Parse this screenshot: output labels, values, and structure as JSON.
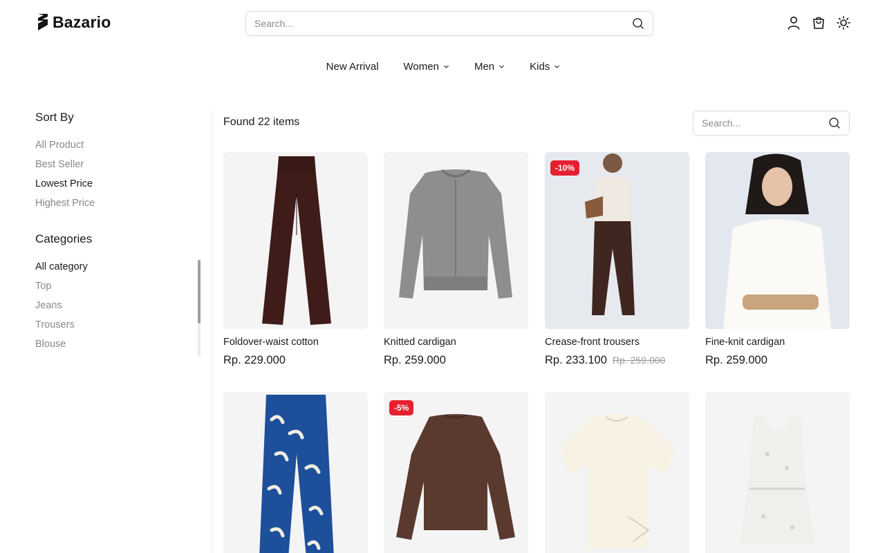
{
  "brand": {
    "name": "Bazario"
  },
  "header": {
    "search_placeholder": "Search...",
    "icons": [
      "user-icon",
      "cart-icon",
      "sun-icon"
    ]
  },
  "nav": [
    {
      "label": "New Arrival",
      "has_dropdown": false
    },
    {
      "label": "Women",
      "has_dropdown": true
    },
    {
      "label": "Men",
      "has_dropdown": true
    },
    {
      "label": "Kids",
      "has_dropdown": true
    }
  ],
  "sidebar": {
    "sort_title": "Sort By",
    "sort_options": [
      "All Product",
      "Best Seller",
      "Lowest Price",
      "Highest Price"
    ],
    "sort_active": "Lowest Price",
    "categories_title": "Categories",
    "categories": [
      "All category",
      "Top",
      "Jeans",
      "Trousers",
      "Blouse"
    ],
    "category_active": "All category"
  },
  "main": {
    "found_text": "Found 22 items",
    "search_placeholder": "Search..."
  },
  "products": [
    {
      "name": "Foldover-waist cotton",
      "price": "Rp. 229.000",
      "old_price": "",
      "badge": ""
    },
    {
      "name": "Knitted cardigan",
      "price": "Rp. 259.000",
      "old_price": "",
      "badge": ""
    },
    {
      "name": "Crease-front trousers",
      "price": "Rp. 233.100",
      "old_price": "Rp. 259.000",
      "badge": "-10%"
    },
    {
      "name": "Fine-knit cardigan",
      "price": "Rp. 259.000",
      "old_price": "",
      "badge": ""
    },
    {
      "name": "",
      "price": "",
      "old_price": "",
      "badge": ""
    },
    {
      "name": "",
      "price": "",
      "old_price": "",
      "badge": "-5%"
    },
    {
      "name": "",
      "price": "",
      "old_price": "",
      "badge": ""
    },
    {
      "name": "",
      "price": "",
      "old_price": "",
      "badge": ""
    }
  ],
  "colors": {
    "badge": "#e6202f",
    "text": "#1a1a1a",
    "muted": "#888888",
    "image_bg": "#f4f4f5"
  }
}
